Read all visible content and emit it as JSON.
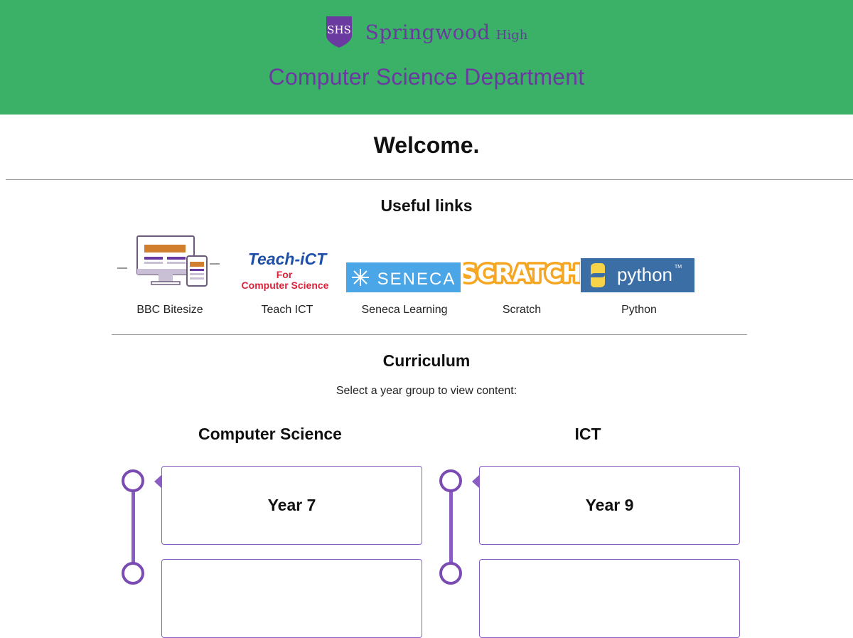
{
  "header": {
    "logo_text": "SHS",
    "school_name": "Springwood",
    "school_suffix": "High",
    "department_title": "Computer Science Department",
    "background_color": "#3ab166",
    "accent_color": "#6a3aa0"
  },
  "welcome": {
    "heading": "Welcome."
  },
  "useful_links": {
    "heading": "Useful links",
    "items": [
      {
        "label": "BBC Bitesize",
        "icon": "computer-devices-icon"
      },
      {
        "label": "Teach ICT",
        "icon": "teach-ict-logo",
        "logo_lines": [
          "Teach-iCT",
          "For",
          "Computer Science"
        ]
      },
      {
        "label": "Seneca Learning",
        "icon": "seneca-logo",
        "logo_text": "SENECA"
      },
      {
        "label": "Scratch",
        "icon": "scratch-logo",
        "logo_text": "SCRATCH"
      },
      {
        "label": "Python",
        "icon": "python-logo",
        "logo_text": "python",
        "trademark": "TM"
      }
    ]
  },
  "curriculum": {
    "heading": "Curriculum",
    "subheading": "Select a year group to view content:",
    "columns": [
      {
        "title": "Computer Science",
        "cards": [
          "Year 7",
          ""
        ]
      },
      {
        "title": "ICT",
        "cards": [
          "Year 9",
          ""
        ]
      }
    ]
  }
}
